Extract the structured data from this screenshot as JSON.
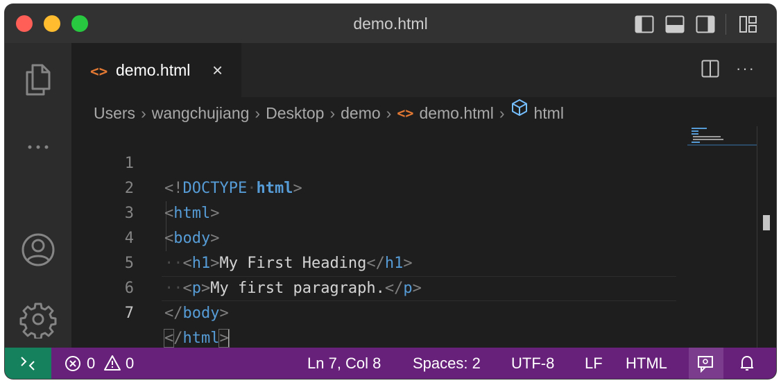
{
  "window": {
    "title": "demo.html"
  },
  "titlebar_icons": [
    "toggle-primary-sidebar-icon",
    "toggle-panel-icon",
    "toggle-secondary-sidebar-icon",
    "customize-layout-icon"
  ],
  "activity_bar": [
    "explorer-icon",
    "more-icon",
    "accounts-icon",
    "manage-gear-icon"
  ],
  "tab": {
    "label": "demo.html",
    "close": "×",
    "icon": "html-file-icon"
  },
  "editor_actions": {
    "split": "split-editor-icon",
    "more": "···"
  },
  "breadcrumb": {
    "items": [
      "Users",
      "wangchujiang",
      "Desktop",
      "demo",
      "demo.html",
      "html"
    ],
    "separator": "›"
  },
  "editor": {
    "active_line": 7,
    "lines": [
      {
        "number": "1"
      },
      {
        "number": "2"
      },
      {
        "number": "3"
      },
      {
        "number": "4"
      },
      {
        "number": "5"
      },
      {
        "number": "6"
      },
      {
        "number": "7"
      }
    ],
    "code": {
      "l1_open": "<!",
      "l1_doctype": "DOCTYPE",
      "l1_html": "html",
      "l1_close": ">",
      "l2_open": "<",
      "l2_tag": "html",
      "l2_close": ">",
      "l3_open": "<",
      "l3_tag": "body",
      "l3_close": ">",
      "l4_indent": "··",
      "l4_open": "<",
      "l4_tag": "h1",
      "l4_close": ">",
      "l4_text": "My First Heading",
      "l4_end_open": "</",
      "l4_end_tag": "h1",
      "l4_end_close": ">",
      "l5_indent": "··",
      "l5_open": "<",
      "l5_tag": "p",
      "l5_close": ">",
      "l5_text": "My first paragraph.",
      "l5_end_open": "</",
      "l5_end_tag": "p",
      "l5_end_close": ">",
      "l6_open": "</",
      "l6_tag": "body",
      "l6_close": ">",
      "l7_lt": "<",
      "l7_slash": "/",
      "l7_tag": "html",
      "l7_close": ">"
    }
  },
  "colors": {
    "status_bar": "#68217a",
    "remote": "#16825d",
    "tag": "#569cd6",
    "text": "#d4d4d4",
    "punctuation": "#808080"
  },
  "status_bar": {
    "errors": "0",
    "warnings": "0",
    "position": "Ln 7, Col 8",
    "spaces": "Spaces: 2",
    "encoding": "UTF-8",
    "eol": "LF",
    "language": "HTML",
    "icons": [
      "remote-icon",
      "error-icon",
      "warning-icon",
      "feedback-icon",
      "bell-icon"
    ]
  }
}
